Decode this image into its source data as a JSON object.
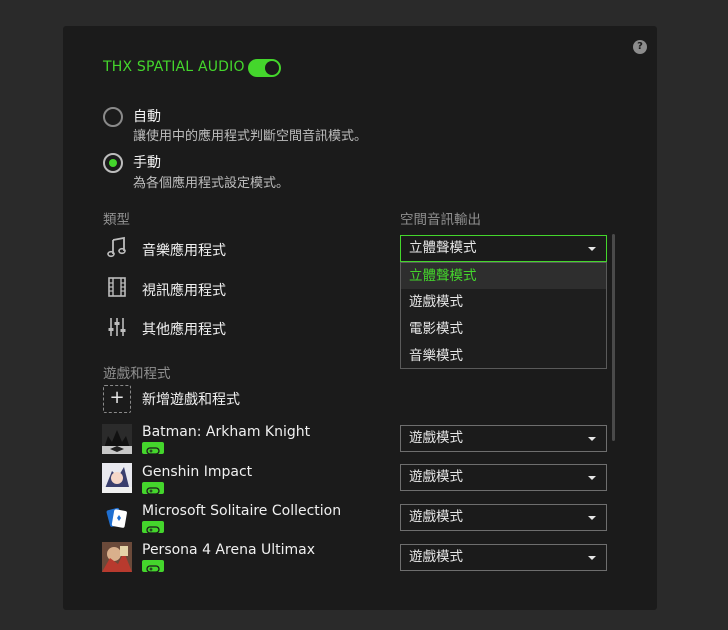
{
  "help_icon": "question-icon",
  "thx": {
    "title": "THX SPATIAL AUDIO",
    "enabled": true
  },
  "modes": [
    {
      "label": "自動",
      "desc": "讓使用中的應用程式判斷空間音訊模式。",
      "checked": false
    },
    {
      "label": "手動",
      "desc": "為各個應用程式設定模式。",
      "checked": true
    }
  ],
  "headers": {
    "type": "類型",
    "output": "空間音訊輸出",
    "games": "遊戲和程式"
  },
  "categories": [
    {
      "label": "音樂應用程式",
      "icon": "music-note-icon",
      "value": "立體聲模式"
    },
    {
      "label": "視訊應用程式",
      "icon": "film-icon"
    },
    {
      "label": "其他應用程式",
      "icon": "sliders-icon"
    }
  ],
  "dropdown_options": [
    "立體聲模式",
    "遊戲模式",
    "電影模式",
    "音樂模式"
  ],
  "add_app": {
    "label": "新增遊戲和程式",
    "icon": "plus-icon"
  },
  "apps": [
    {
      "name": "Batman: Arkham Knight",
      "value": "遊戲模式",
      "badge_icon": "gamepad-icon"
    },
    {
      "name": "Genshin Impact",
      "value": "遊戲模式",
      "badge_icon": "gamepad-icon"
    },
    {
      "name": "Microsoft Solitaire Collection",
      "value": "遊戲模式",
      "badge_icon": "gamepad-icon"
    },
    {
      "name": "Persona 4 Arena Ultimax",
      "value": "遊戲模式",
      "badge_icon": "gamepad-icon"
    }
  ],
  "colors": {
    "accent": "#44d62c",
    "panel": "#1b1b1b",
    "background": "#2a2a2a"
  }
}
